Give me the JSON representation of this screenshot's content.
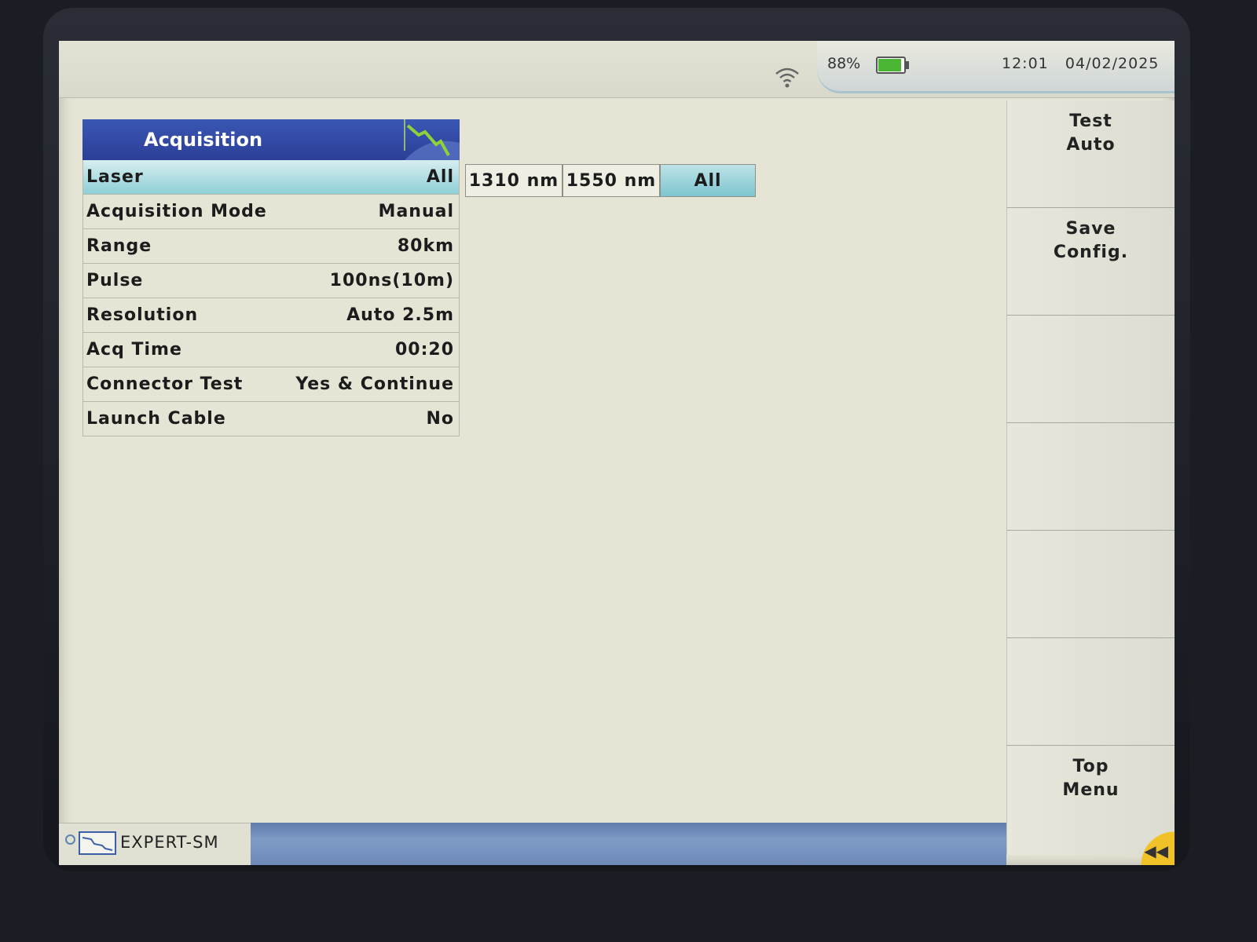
{
  "status": {
    "battery_pct": "88%",
    "time": "12:01",
    "date": "04/02/2025",
    "icons": [
      "wifi-icon",
      "battery-icon"
    ]
  },
  "acquisition": {
    "title": "Acquisition",
    "rows": [
      {
        "label": "Laser",
        "value": "All"
      },
      {
        "label": "Acquisition Mode",
        "value": "Manual"
      },
      {
        "label": "Range",
        "value": "80km"
      },
      {
        "label": "Pulse",
        "value": "100ns(10m)"
      },
      {
        "label": "Resolution",
        "value": "Auto 2.5m"
      },
      {
        "label": "Acq Time",
        "value": "00:20"
      },
      {
        "label": "Connector Test",
        "value": "Yes & Continue"
      },
      {
        "label": "Launch Cable",
        "value": "No"
      }
    ]
  },
  "laser_options": {
    "items": [
      "1310 nm",
      "1550 nm",
      "All"
    ],
    "selected": "All"
  },
  "softkeys": {
    "test_auto_line1": "Test",
    "test_auto_line2": "Auto",
    "save_config_line1": "Save",
    "save_config_line2": "Config.",
    "top_menu_line1": "Top",
    "top_menu_line2": "Menu"
  },
  "bottom": {
    "app_name": "EXPERT-SM"
  },
  "colors": {
    "header_blue": "#2b3f96",
    "selected_teal": "#8fcfd7",
    "screen_bg": "#e6e5d5",
    "battery_green": "#4bb534",
    "corner_yellow": "#f1c227"
  }
}
